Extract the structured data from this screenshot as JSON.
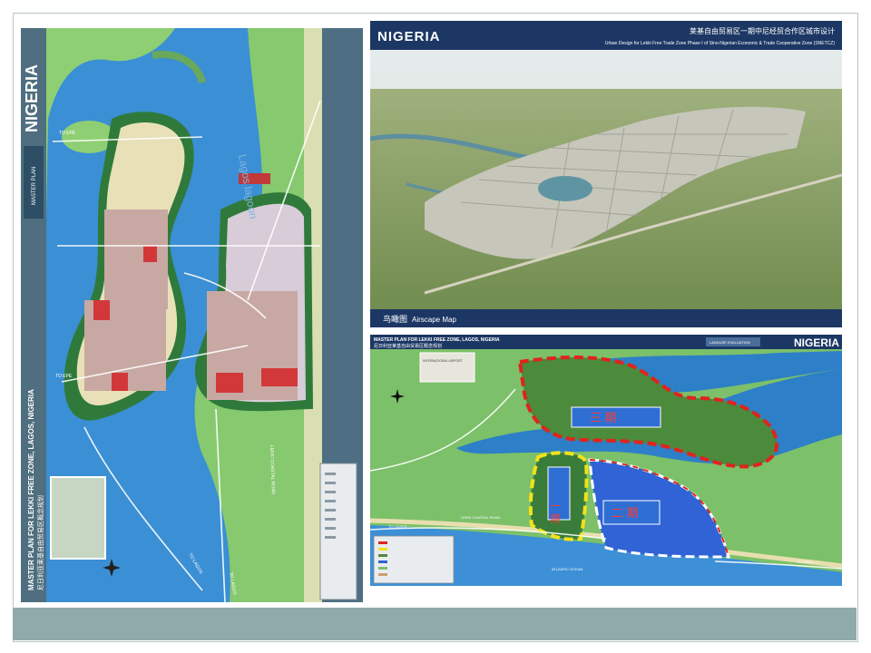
{
  "left_map": {
    "brand": "NIGERIA",
    "plan_label": "MASTER PLAN",
    "title": "MASTER PLAN FOR LEKKI FREE ZONE, LAGOS, NIGERIA",
    "title_cn": "尼日利亚莱基自由贸易区概念规划",
    "lagoon_label": "Lagos lagoon",
    "road_labels": [
      "TO EPE",
      "TO EPE",
      "TO LAGOS",
      "TO LAGOS",
      "LEKKI COASTAL ROAD"
    ]
  },
  "aerial": {
    "brand": "NIGERIA",
    "title_cn": "莱基自由贸易区一期中尼经贸合作区城市设计",
    "title_en": "Urban Design for Lekki Free Trade Zone Phase I of Sino-Nigerian Economic & Trade Cooperative Zone (SNETCZ)",
    "caption_cn": "鸟瞰图",
    "caption_en": "Airscape Map"
  },
  "landuse": {
    "title": "MASTER PLAN FOR LEKKI FREE ZONE, LAGOS, NIGERIA",
    "title_cn": "尼日利亚莱基自由贸易区概念规划",
    "badge": "LANDUSE EVALUATION",
    "brand": "NIGERIA",
    "phase_labels": [
      "三 期",
      "一 期",
      "二 期"
    ],
    "place_labels": [
      "INTERNATIONAL AIRPORT",
      "TO LAGOS",
      "LEKKI COASTAL ROAD",
      "TO LEKKI",
      "ATLANTIC OCEAN"
    ]
  },
  "colors": {
    "lagoon": "#2f8ad0",
    "land": "#7fc46e",
    "ocean": "#3d8fd6",
    "footer": "#8faaab",
    "header_navy": "#1c3764",
    "phase_red": "#e0241c",
    "phase_yellow": "#f2e21a"
  }
}
